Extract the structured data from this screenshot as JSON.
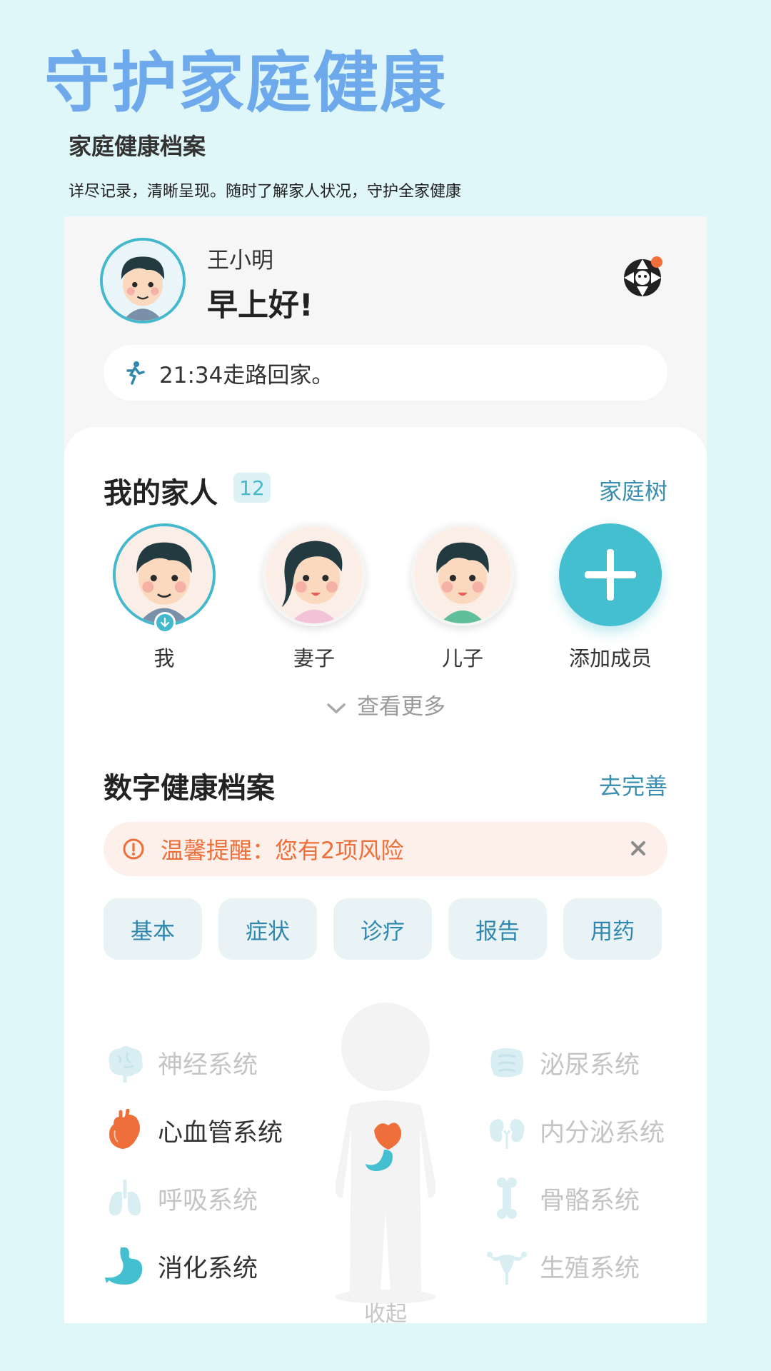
{
  "promo": {
    "title": "守护家庭健康",
    "subtitle": "家庭健康档案",
    "description": "详尽记录，清晰呈现。随时了解家人状况，守护全家健康"
  },
  "header": {
    "user_name": "王小明",
    "greeting": "早上好!",
    "activity": "21:34走路回家。"
  },
  "family": {
    "title": "我的家人",
    "count": "12",
    "link": "家庭树",
    "members": [
      {
        "label": "我"
      },
      {
        "label": "妻子"
      },
      {
        "label": "儿子"
      },
      {
        "label": "添加成员"
      }
    ],
    "more": "查看更多"
  },
  "records": {
    "title": "数字健康档案",
    "link": "去完善",
    "alert": "温馨提醒：您有2项风险",
    "tabs": [
      "基本",
      "症状",
      "诊疗",
      "报告",
      "用药"
    ],
    "systems_left": [
      {
        "label": "神经系统",
        "icon": "brain-icon",
        "active": false
      },
      {
        "label": "心血管系统",
        "icon": "heart-icon",
        "active": true
      },
      {
        "label": "呼吸系统",
        "icon": "lungs-icon",
        "active": false
      },
      {
        "label": "消化系统",
        "icon": "stomach-icon",
        "active": true
      }
    ],
    "systems_right": [
      {
        "label": "泌尿系统",
        "icon": "intestine-icon",
        "active": false
      },
      {
        "label": "内分泌系统",
        "icon": "kidney-icon",
        "active": false
      },
      {
        "label": "骨骼系统",
        "icon": "bone-icon",
        "active": false
      },
      {
        "label": "生殖系统",
        "icon": "uterus-icon",
        "active": false
      }
    ],
    "bottom_cut_text": "收起"
  },
  "colors": {
    "background": "#dff7f8",
    "promo_title": "#6ea9ec",
    "accent": "#44b8cd",
    "alert_text": "#ee6f3a",
    "alert_bg": "#fdefea",
    "tab_text": "#2f87ad"
  }
}
